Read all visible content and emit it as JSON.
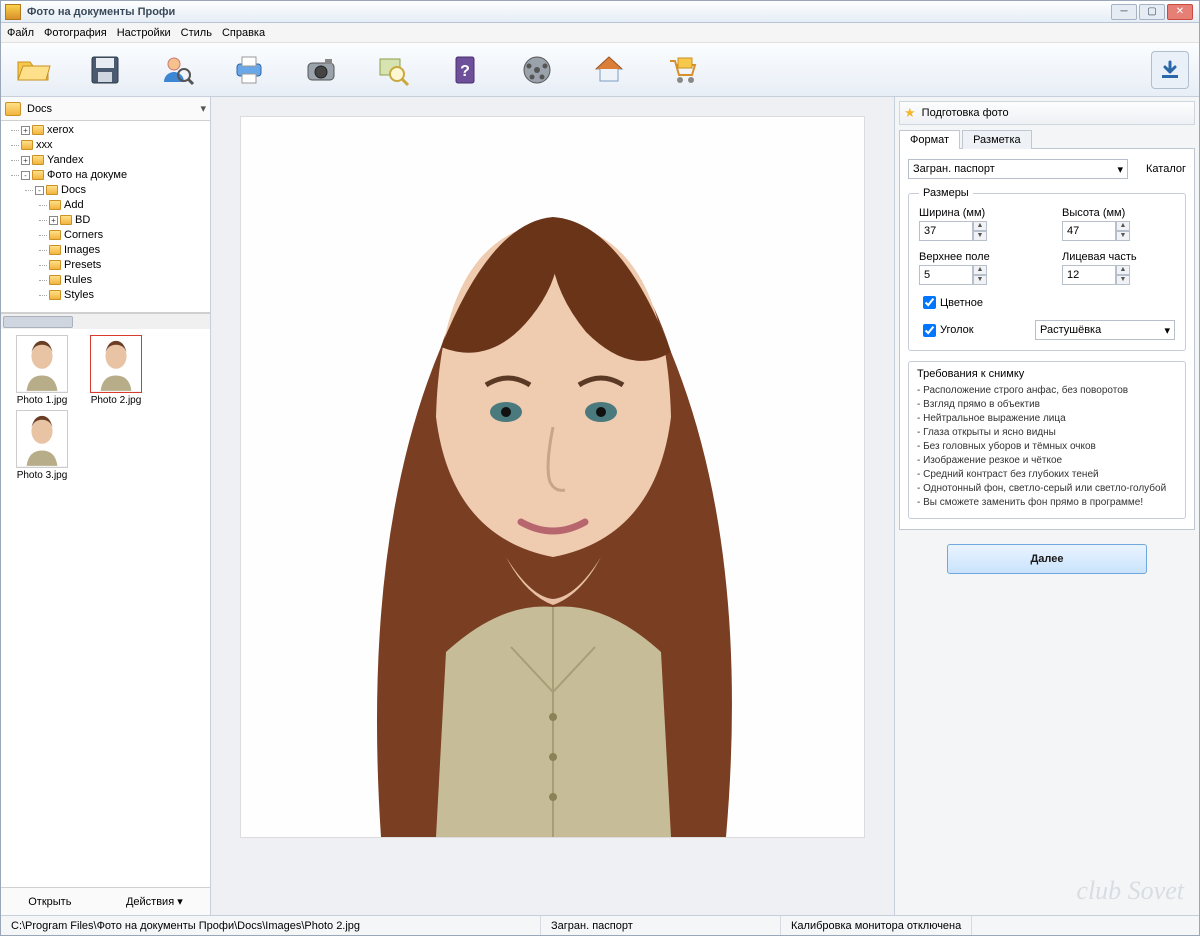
{
  "title": "Фото на документы Профи",
  "menu": {
    "file": "Файл",
    "photo": "Фотография",
    "settings": "Настройки",
    "style": "Стиль",
    "help": "Справка"
  },
  "toolbar": {
    "open": "open-folder",
    "save": "save",
    "user": "user-zoom",
    "print": "print",
    "camera": "camera",
    "magnify": "magnify",
    "book": "help-book",
    "video": "video",
    "home": "home",
    "cart": "cart",
    "download": "download"
  },
  "sidebar": {
    "current_folder": "Docs",
    "tree": [
      {
        "name": "xerox",
        "toggle": "+"
      },
      {
        "name": "xxx"
      },
      {
        "name": "Yandex",
        "toggle": "+"
      },
      {
        "name": "Фото на докуме",
        "toggle": "-",
        "children": [
          {
            "name": "Docs",
            "toggle": "-",
            "children": [
              {
                "name": "Add"
              },
              {
                "name": "BD",
                "toggle": "+"
              },
              {
                "name": "Corners"
              },
              {
                "name": "Images"
              },
              {
                "name": "Presets"
              },
              {
                "name": "Rules"
              },
              {
                "name": "Styles"
              }
            ]
          }
        ]
      }
    ],
    "thumbs": [
      {
        "name": "Photo 1.jpg",
        "selected": false
      },
      {
        "name": "Photo 2.jpg",
        "selected": true
      },
      {
        "name": "Photo 3.jpg",
        "selected": false
      }
    ],
    "open_btn": "Открыть",
    "actions_btn": "Действия"
  },
  "panel": {
    "heading": "Подготовка фото",
    "tabs": {
      "format": "Формат",
      "layout": "Разметка"
    },
    "format_select": "Загран. паспорт",
    "catalog": "Каталог",
    "sizes_legend": "Размеры",
    "width_label": "Ширина (мм)",
    "width_value": "37",
    "height_label": "Высота (мм)",
    "height_value": "47",
    "top_label": "Верхнее поле",
    "top_value": "5",
    "face_label": "Лицевая часть",
    "face_value": "12",
    "color_label": "Цветное",
    "color_checked": true,
    "corner_label": "Уголок",
    "corner_checked": true,
    "shading_select": "Растушёвка",
    "reqs_title": "Требования к снимку",
    "reqs": [
      "Расположение строго анфас, без поворотов",
      "Взгляд прямо в объектив",
      "Нейтральное выражение лица",
      "Глаза открыты и ясно видны",
      "Без головных уборов и тёмных очков",
      "Изображение резкое и чёткое",
      "Средний контраст без глубоких теней",
      "Однотонный фон, светло-серый или светло-голубой",
      "Вы сможете заменить фон прямо в программе!"
    ],
    "next": "Далее"
  },
  "status": {
    "path": "C:\\Program Files\\Фото на документы Профи\\Docs\\Images\\Photo 2.jpg",
    "format": "Загран. паспорт",
    "calib": "Калибровка монитора отключена"
  },
  "watermark": "club Sovet"
}
